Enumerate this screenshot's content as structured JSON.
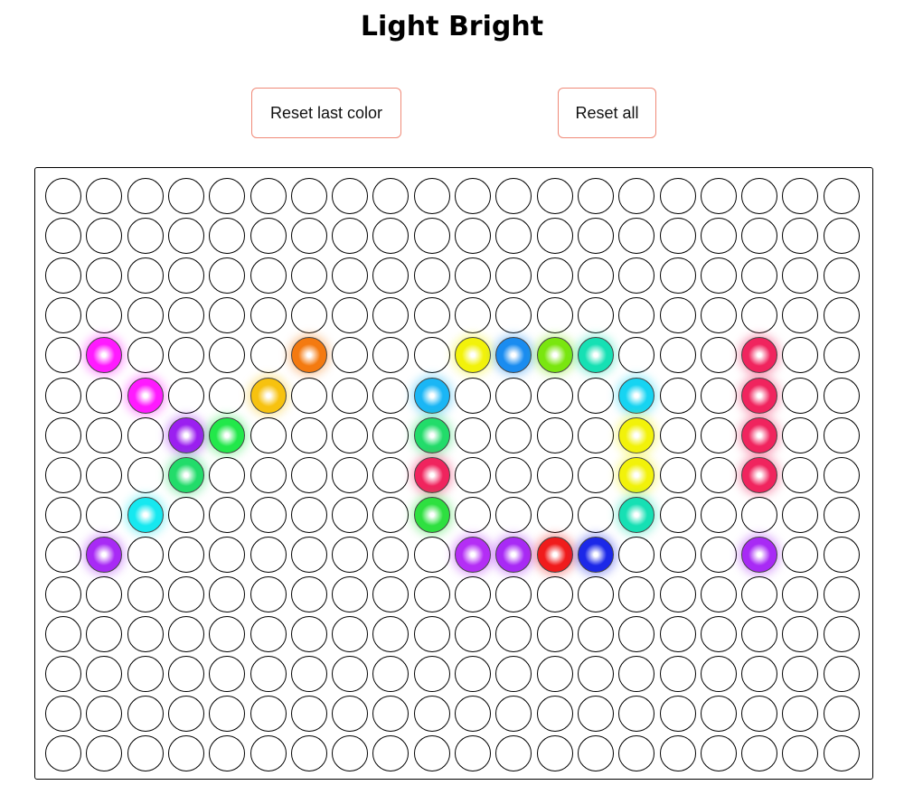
{
  "title": "Light Bright",
  "buttons": {
    "reset_last": "Reset last color",
    "reset_all": "Reset all"
  },
  "board": {
    "rows": 15,
    "cols": 20,
    "lit": [
      {
        "row": 4,
        "col": 1,
        "color": "#ff1aff"
      },
      {
        "row": 4,
        "col": 6,
        "color": "#f47a10"
      },
      {
        "row": 4,
        "col": 10,
        "color": "#f2f20a"
      },
      {
        "row": 4,
        "col": 11,
        "color": "#1a8cf0"
      },
      {
        "row": 4,
        "col": 12,
        "color": "#7ae60f"
      },
      {
        "row": 4,
        "col": 13,
        "color": "#16e0b4"
      },
      {
        "row": 4,
        "col": 17,
        "color": "#f0245e"
      },
      {
        "row": 5,
        "col": 2,
        "color": "#ff1aff"
      },
      {
        "row": 5,
        "col": 5,
        "color": "#f7c20f"
      },
      {
        "row": 5,
        "col": 9,
        "color": "#1ab6f5"
      },
      {
        "row": 5,
        "col": 14,
        "color": "#16d4f2"
      },
      {
        "row": 5,
        "col": 17,
        "color": "#f0245e"
      },
      {
        "row": 6,
        "col": 3,
        "color": "#9b1ff0"
      },
      {
        "row": 6,
        "col": 4,
        "color": "#22e84a"
      },
      {
        "row": 6,
        "col": 9,
        "color": "#22dc6a"
      },
      {
        "row": 6,
        "col": 14,
        "color": "#f2f20a"
      },
      {
        "row": 6,
        "col": 17,
        "color": "#f0245e"
      },
      {
        "row": 7,
        "col": 3,
        "color": "#22dc6a"
      },
      {
        "row": 7,
        "col": 9,
        "color": "#f0245e"
      },
      {
        "row": 7,
        "col": 14,
        "color": "#f2f20a"
      },
      {
        "row": 7,
        "col": 17,
        "color": "#f0245e"
      },
      {
        "row": 8,
        "col": 2,
        "color": "#16e8f0"
      },
      {
        "row": 8,
        "col": 9,
        "color": "#2ee040"
      },
      {
        "row": 8,
        "col": 14,
        "color": "#16e0b4"
      },
      {
        "row": 9,
        "col": 1,
        "color": "#a82af5"
      },
      {
        "row": 9,
        "col": 10,
        "color": "#b42ef5"
      },
      {
        "row": 9,
        "col": 11,
        "color": "#a82af5"
      },
      {
        "row": 9,
        "col": 12,
        "color": "#f01c1c"
      },
      {
        "row": 9,
        "col": 13,
        "color": "#1c28e8"
      },
      {
        "row": 9,
        "col": 17,
        "color": "#a82af5"
      }
    ]
  }
}
